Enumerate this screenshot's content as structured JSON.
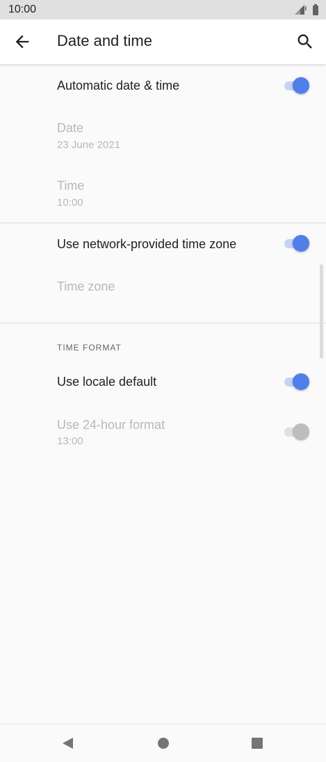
{
  "status_bar": {
    "time": "10:00"
  },
  "app_bar": {
    "title": "Date and time"
  },
  "settings": {
    "automatic_datetime": {
      "label": "Automatic date & time",
      "enabled": true
    },
    "date": {
      "label": "Date",
      "value": "23 June 2021"
    },
    "time": {
      "label": "Time",
      "value": "10:00"
    },
    "network_timezone": {
      "label": "Use network-provided time zone",
      "enabled": true
    },
    "time_zone": {
      "label": "Time zone"
    },
    "section_time_format": "TIME FORMAT",
    "locale_default": {
      "label": "Use locale default",
      "enabled": true
    },
    "hour24": {
      "label": "Use 24-hour format",
      "value": "13:00",
      "enabled": false
    }
  },
  "colors": {
    "accent": "#4f7fe8",
    "accent_track": "#c5d4f5",
    "disabled_text": "#b8b8b8"
  },
  "icons": {
    "back": "arrow-left-icon",
    "search": "search-icon",
    "nav_back": "triangle-back-icon",
    "nav_home": "circle-home-icon",
    "nav_recents": "square-recents-icon"
  }
}
